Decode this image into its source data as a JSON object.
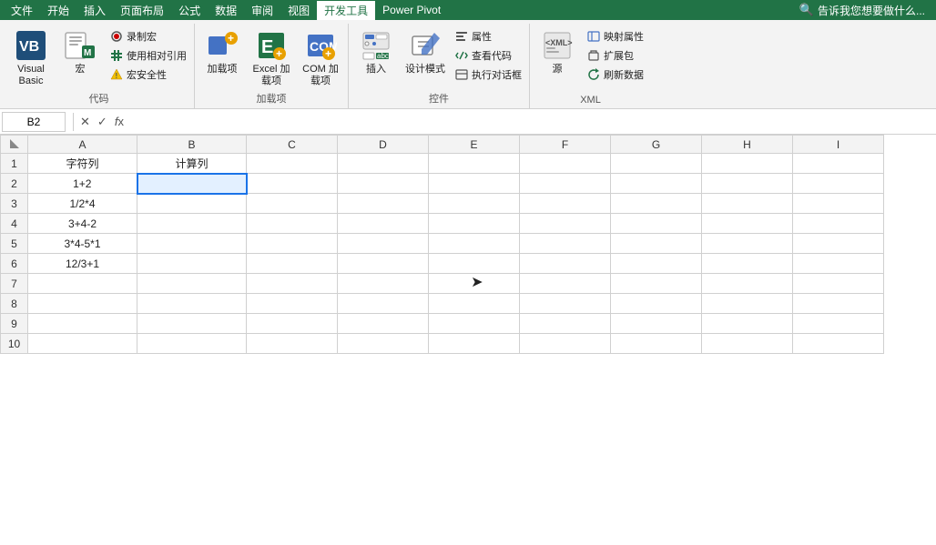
{
  "menubar": {
    "items": [
      "文件",
      "开始",
      "插入",
      "页面布局",
      "公式",
      "数据",
      "审阅",
      "视图",
      "开发工具",
      "Power Pivot"
    ],
    "active": "开发工具",
    "search_placeholder": "告诉我您想要做什么..."
  },
  "ribbon": {
    "groups": [
      {
        "label": "代码",
        "items_large": [
          {
            "id": "visual-basic",
            "label": "Visual Basic",
            "icon": "vb"
          },
          {
            "id": "macro",
            "label": "宏",
            "icon": "macro"
          }
        ],
        "items_small": [
          {
            "id": "record-macro",
            "label": "录制宏",
            "icon": "record"
          },
          {
            "id": "relative-ref",
            "label": "使用相对引用",
            "icon": "relative"
          },
          {
            "id": "macro-security",
            "label": "宏安全性",
            "icon": "security"
          }
        ]
      },
      {
        "label": "加载项",
        "items_large": [
          {
            "id": "add-ins",
            "label": "加载项",
            "icon": "addins"
          },
          {
            "id": "excel-addins",
            "label": "Excel 加载项",
            "icon": "exceladdin"
          },
          {
            "id": "com-addins",
            "label": "COM 加载项",
            "icon": "comaddin"
          }
        ],
        "items_small": []
      },
      {
        "label": "控件",
        "items_large": [
          {
            "id": "insert-ctrl",
            "label": "插入",
            "icon": "insert"
          },
          {
            "id": "design-mode",
            "label": "设计模式",
            "icon": "design"
          }
        ],
        "items_small": [
          {
            "id": "properties",
            "label": "属性",
            "icon": "properties"
          },
          {
            "id": "view-code",
            "label": "查看代码",
            "icon": "viewcode"
          },
          {
            "id": "run-dialog",
            "label": "执行对话框",
            "icon": "dialog"
          }
        ]
      },
      {
        "label": "XML",
        "items_large": [
          {
            "id": "source",
            "label": "源",
            "icon": "source"
          }
        ],
        "items_small": [
          {
            "id": "map-properties",
            "label": "映射属性",
            "icon": "mapproperties"
          },
          {
            "id": "expand-pack",
            "label": "扩展包",
            "icon": "expandpack"
          },
          {
            "id": "refresh-data",
            "label": "刷新数据",
            "icon": "refreshdata"
          }
        ]
      }
    ]
  },
  "formula_bar": {
    "cell_ref": "B2",
    "formula": ""
  },
  "sheet": {
    "columns": [
      "A",
      "B",
      "C",
      "D",
      "E",
      "F",
      "G",
      "H",
      "I"
    ],
    "rows": [
      {
        "row": 1,
        "cells": [
          "字符列",
          "计算列",
          "",
          "",
          "",
          "",
          "",
          "",
          ""
        ]
      },
      {
        "row": 2,
        "cells": [
          "1+2",
          "",
          "",
          "",
          "",
          "",
          "",
          "",
          ""
        ]
      },
      {
        "row": 3,
        "cells": [
          "1/2*4",
          "",
          "",
          "",
          "",
          "",
          "",
          "",
          ""
        ]
      },
      {
        "row": 4,
        "cells": [
          "3+4-2",
          "",
          "",
          "",
          "",
          "",
          "",
          "",
          ""
        ]
      },
      {
        "row": 5,
        "cells": [
          "3*4-5*1",
          "",
          "",
          "",
          "",
          "",
          "",
          "",
          ""
        ]
      },
      {
        "row": 6,
        "cells": [
          "12/3+1",
          "",
          "",
          "",
          "",
          "",
          "",
          "",
          ""
        ]
      },
      {
        "row": 7,
        "cells": [
          "",
          "",
          "",
          "",
          "",
          "",
          "",
          "",
          ""
        ]
      },
      {
        "row": 8,
        "cells": [
          "",
          "",
          "",
          "",
          "",
          "",
          "",
          "",
          ""
        ]
      },
      {
        "row": 9,
        "cells": [
          "",
          "",
          "",
          "",
          "",
          "",
          "",
          "",
          ""
        ]
      },
      {
        "row": 10,
        "cells": [
          "",
          "",
          "",
          "",
          "",
          "",
          "",
          "",
          ""
        ]
      }
    ],
    "selected_cell": {
      "row": 2,
      "col": 1
    }
  }
}
